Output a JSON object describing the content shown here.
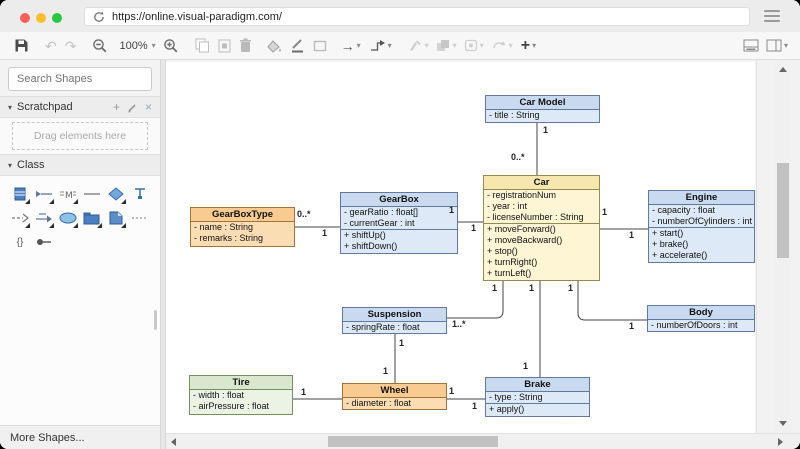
{
  "browser": {
    "url": "https://online.visual-paradigm.com/",
    "traffic_lights": {
      "close": "#ff5f57",
      "minimize": "#febc2e",
      "zoom": "#28c840"
    }
  },
  "toolbar": {
    "zoom_level": "100%",
    "icons": [
      "save",
      "undo",
      "redo",
      "zoom-out",
      "zoom-level-dropdown",
      "zoom-in",
      "copy",
      "paste",
      "delete",
      "fill-color",
      "line-color",
      "shape-style",
      "arrow-style",
      "connector-style",
      "format-painter",
      "bring-forward",
      "align-shape",
      "rotate-shape",
      "insert",
      "toggle-format-panel",
      "toggle-layout-panel"
    ]
  },
  "sidebar": {
    "search_placeholder": "Search Shapes",
    "scratchpad_title": "Scratchpad",
    "scratchpad_hint": "Drag elements here",
    "class_title": "Class",
    "more_shapes": "More Shapes...",
    "palette_icons": [
      "class",
      "aggregation",
      "association-class",
      "line",
      "diamond",
      "containment",
      "dependency",
      "directed-association",
      "ellipse",
      "package",
      "note",
      "dashed-line",
      "constraint",
      "pin"
    ]
  },
  "diagram": {
    "colors": {
      "blue_header": "#c9daf0",
      "blue_body": "#dde9f7",
      "yellow_header": "#f6e7ae",
      "yellow_body": "#fdf5d4",
      "orange_header": "#f8cb90",
      "orange_body": "#fbddb3",
      "green_header": "#d9e7ce",
      "green_body": "#ebf3e4"
    },
    "classes": [
      {
        "name": "Car Model",
        "attributes": [
          "- title : String"
        ],
        "operations": []
      },
      {
        "name": "Car",
        "attributes": [
          "- registrationNum",
          "- year : int",
          "- licenseNumber : String"
        ],
        "operations": [
          "+ moveForward()",
          "+ moveBackward()",
          "+ stop()",
          "+ turnRight()",
          "+ turnLeft()"
        ]
      },
      {
        "name": "GearBox",
        "attributes": [
          "- gearRatio : float[]",
          "- currentGear : int"
        ],
        "operations": [
          "+ shiftUp()",
          "+ shiftDown()"
        ]
      },
      {
        "name": "GearBoxType",
        "attributes": [
          "- name : String",
          "- remarks : String"
        ],
        "operations": []
      },
      {
        "name": "Engine",
        "attributes": [
          "- capacity : float",
          "- numberOfCylinders : int"
        ],
        "operations": [
          "+ start()",
          "+ brake()",
          "+ accelerate()"
        ]
      },
      {
        "name": "Suspension",
        "attributes": [
          "- springRate : float"
        ],
        "operations": []
      },
      {
        "name": "Body",
        "attributes": [
          "- numberOfDoors : int"
        ],
        "operations": []
      },
      {
        "name": "Tire",
        "attributes": [
          "- width : float",
          "- airPressure : float"
        ],
        "operations": []
      },
      {
        "name": "Wheel",
        "attributes": [
          "- diameter : float"
        ],
        "operations": []
      },
      {
        "name": "Brake",
        "attributes": [
          "- type : String"
        ],
        "operations": [
          "+ apply()"
        ]
      }
    ],
    "labels": [
      "1",
      "0..*",
      "0..*",
      "1",
      "1",
      "1",
      "1",
      "1",
      "1",
      "1..*",
      "1",
      "1",
      "1",
      "1",
      "1",
      "1",
      "1",
      "1",
      "1"
    ]
  }
}
